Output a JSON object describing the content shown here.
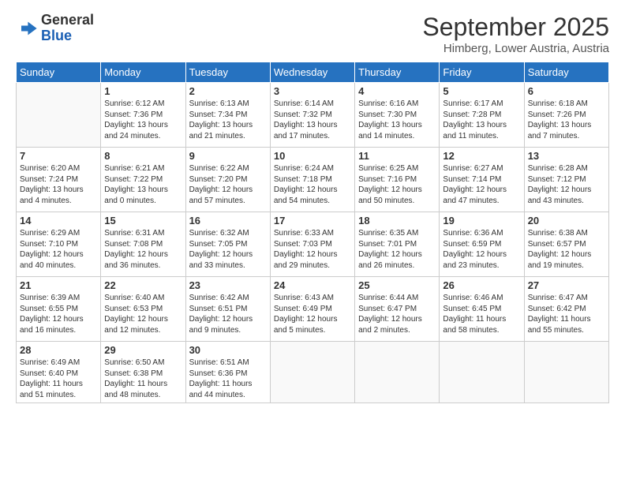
{
  "logo": {
    "general": "General",
    "blue": "Blue"
  },
  "title": "September 2025",
  "subtitle": "Himberg, Lower Austria, Austria",
  "headers": [
    "Sunday",
    "Monday",
    "Tuesday",
    "Wednesday",
    "Thursday",
    "Friday",
    "Saturday"
  ],
  "weeks": [
    [
      {
        "day": "",
        "info": ""
      },
      {
        "day": "1",
        "info": "Sunrise: 6:12 AM\nSunset: 7:36 PM\nDaylight: 13 hours\nand 24 minutes."
      },
      {
        "day": "2",
        "info": "Sunrise: 6:13 AM\nSunset: 7:34 PM\nDaylight: 13 hours\nand 21 minutes."
      },
      {
        "day": "3",
        "info": "Sunrise: 6:14 AM\nSunset: 7:32 PM\nDaylight: 13 hours\nand 17 minutes."
      },
      {
        "day": "4",
        "info": "Sunrise: 6:16 AM\nSunset: 7:30 PM\nDaylight: 13 hours\nand 14 minutes."
      },
      {
        "day": "5",
        "info": "Sunrise: 6:17 AM\nSunset: 7:28 PM\nDaylight: 13 hours\nand 11 minutes."
      },
      {
        "day": "6",
        "info": "Sunrise: 6:18 AM\nSunset: 7:26 PM\nDaylight: 13 hours\nand 7 minutes."
      }
    ],
    [
      {
        "day": "7",
        "info": "Sunrise: 6:20 AM\nSunset: 7:24 PM\nDaylight: 13 hours\nand 4 minutes."
      },
      {
        "day": "8",
        "info": "Sunrise: 6:21 AM\nSunset: 7:22 PM\nDaylight: 13 hours\nand 0 minutes."
      },
      {
        "day": "9",
        "info": "Sunrise: 6:22 AM\nSunset: 7:20 PM\nDaylight: 12 hours\nand 57 minutes."
      },
      {
        "day": "10",
        "info": "Sunrise: 6:24 AM\nSunset: 7:18 PM\nDaylight: 12 hours\nand 54 minutes."
      },
      {
        "day": "11",
        "info": "Sunrise: 6:25 AM\nSunset: 7:16 PM\nDaylight: 12 hours\nand 50 minutes."
      },
      {
        "day": "12",
        "info": "Sunrise: 6:27 AM\nSunset: 7:14 PM\nDaylight: 12 hours\nand 47 minutes."
      },
      {
        "day": "13",
        "info": "Sunrise: 6:28 AM\nSunset: 7:12 PM\nDaylight: 12 hours\nand 43 minutes."
      }
    ],
    [
      {
        "day": "14",
        "info": "Sunrise: 6:29 AM\nSunset: 7:10 PM\nDaylight: 12 hours\nand 40 minutes."
      },
      {
        "day": "15",
        "info": "Sunrise: 6:31 AM\nSunset: 7:08 PM\nDaylight: 12 hours\nand 36 minutes."
      },
      {
        "day": "16",
        "info": "Sunrise: 6:32 AM\nSunset: 7:05 PM\nDaylight: 12 hours\nand 33 minutes."
      },
      {
        "day": "17",
        "info": "Sunrise: 6:33 AM\nSunset: 7:03 PM\nDaylight: 12 hours\nand 29 minutes."
      },
      {
        "day": "18",
        "info": "Sunrise: 6:35 AM\nSunset: 7:01 PM\nDaylight: 12 hours\nand 26 minutes."
      },
      {
        "day": "19",
        "info": "Sunrise: 6:36 AM\nSunset: 6:59 PM\nDaylight: 12 hours\nand 23 minutes."
      },
      {
        "day": "20",
        "info": "Sunrise: 6:38 AM\nSunset: 6:57 PM\nDaylight: 12 hours\nand 19 minutes."
      }
    ],
    [
      {
        "day": "21",
        "info": "Sunrise: 6:39 AM\nSunset: 6:55 PM\nDaylight: 12 hours\nand 16 minutes."
      },
      {
        "day": "22",
        "info": "Sunrise: 6:40 AM\nSunset: 6:53 PM\nDaylight: 12 hours\nand 12 minutes."
      },
      {
        "day": "23",
        "info": "Sunrise: 6:42 AM\nSunset: 6:51 PM\nDaylight: 12 hours\nand 9 minutes."
      },
      {
        "day": "24",
        "info": "Sunrise: 6:43 AM\nSunset: 6:49 PM\nDaylight: 12 hours\nand 5 minutes."
      },
      {
        "day": "25",
        "info": "Sunrise: 6:44 AM\nSunset: 6:47 PM\nDaylight: 12 hours\nand 2 minutes."
      },
      {
        "day": "26",
        "info": "Sunrise: 6:46 AM\nSunset: 6:45 PM\nDaylight: 11 hours\nand 58 minutes."
      },
      {
        "day": "27",
        "info": "Sunrise: 6:47 AM\nSunset: 6:42 PM\nDaylight: 11 hours\nand 55 minutes."
      }
    ],
    [
      {
        "day": "28",
        "info": "Sunrise: 6:49 AM\nSunset: 6:40 PM\nDaylight: 11 hours\nand 51 minutes."
      },
      {
        "day": "29",
        "info": "Sunrise: 6:50 AM\nSunset: 6:38 PM\nDaylight: 11 hours\nand 48 minutes."
      },
      {
        "day": "30",
        "info": "Sunrise: 6:51 AM\nSunset: 6:36 PM\nDaylight: 11 hours\nand 44 minutes."
      },
      {
        "day": "",
        "info": ""
      },
      {
        "day": "",
        "info": ""
      },
      {
        "day": "",
        "info": ""
      },
      {
        "day": "",
        "info": ""
      }
    ]
  ]
}
